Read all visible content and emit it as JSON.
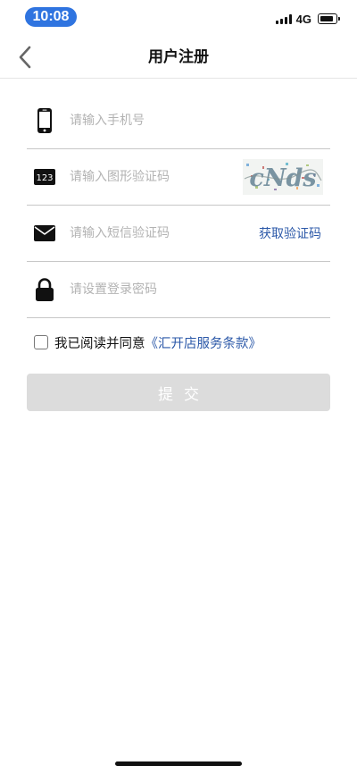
{
  "status_bar": {
    "time": "10:08",
    "network": "4G"
  },
  "nav": {
    "title": "用户注册",
    "back_icon": "chevron-left-icon"
  },
  "form": {
    "phone": {
      "icon": "smartphone-icon",
      "placeholder": "请输入手机号",
      "value": ""
    },
    "image_code": {
      "icon_label": "123",
      "icon": "number-code-icon",
      "placeholder": "请输入图形验证码",
      "value": "",
      "captcha_text": "cNds"
    },
    "sms_code": {
      "icon": "envelope-icon",
      "placeholder": "请输入短信验证码",
      "value": "",
      "get_code_label": "获取验证码"
    },
    "password": {
      "icon": "lock-icon",
      "placeholder": "请设置登录密码",
      "value": ""
    }
  },
  "agreement": {
    "checked": false,
    "text": "我已阅读并同意",
    "link_text": "《汇开店服务条款》"
  },
  "submit": {
    "label": "提交"
  },
  "colors": {
    "time_pill": "#2f74e0",
    "link": "#2b58a8",
    "submit_disabled": "#dcdcdc",
    "placeholder": "#b3b3b3",
    "divider": "#c7c7c7"
  }
}
